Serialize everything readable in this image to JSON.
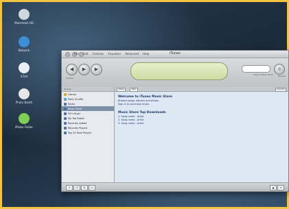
{
  "desktop": {
    "icons": [
      {
        "label": "Macintosh HD",
        "color": "#cfd8e0"
      },
      {
        "label": "Network",
        "color": "#3f8ed8"
      },
      {
        "label": "iChat",
        "color": "#e8f0f6"
      },
      {
        "label": "Photo Booth",
        "color": "#e6e6e6"
      },
      {
        "label": "iPhoto Folder",
        "color": "#7fcf56"
      }
    ]
  },
  "window": {
    "title": "iTunes",
    "menu": [
      "File",
      "Edit",
      "Controls",
      "Visualizer",
      "Advanced",
      "Help"
    ],
    "toolbar": {
      "display_symbol": "",
      "search_label": "Search Music Store",
      "browse_label": "Browse",
      "volume_label": "Volume"
    },
    "sidebar": {
      "header": "Source",
      "items": [
        {
          "label": "Library",
          "color": "#d9a928"
        },
        {
          "label": "Party Shuffle",
          "color": "#5b9fd9"
        },
        {
          "label": "Radio",
          "color": "#4d6da4"
        },
        {
          "label": "Music Store",
          "color": "#3f71a9",
          "selected": true
        },
        {
          "label": "90's Music",
          "color": "#5070a0"
        },
        {
          "label": "My Top Rated",
          "color": "#5070a0"
        },
        {
          "label": "Recently Added",
          "color": "#5070a0"
        },
        {
          "label": "Recently Played",
          "color": "#5070a0"
        },
        {
          "label": "Top 25 Most Played",
          "color": "#5070a0"
        }
      ]
    },
    "main": {
      "header_buttons": [
        "Home",
        "Back"
      ],
      "account_label": "Account",
      "sections": [
        {
          "heading": "Welcome to iTunes Music Store",
          "lines": [
            "Browse songs, albums and artists.",
            "Sign in to purchase music."
          ]
        },
        {
          "heading": "Music Store Top Downloads",
          "lines": [
            "1. Song name - Artist",
            "2. Song name - Artist",
            "3. Song name - Artist"
          ]
        }
      ]
    },
    "statusbar": {
      "buttons": [
        "+",
        "⤮",
        "↻",
        "▭"
      ],
      "right_buttons": [
        "≡",
        "▲"
      ]
    }
  }
}
